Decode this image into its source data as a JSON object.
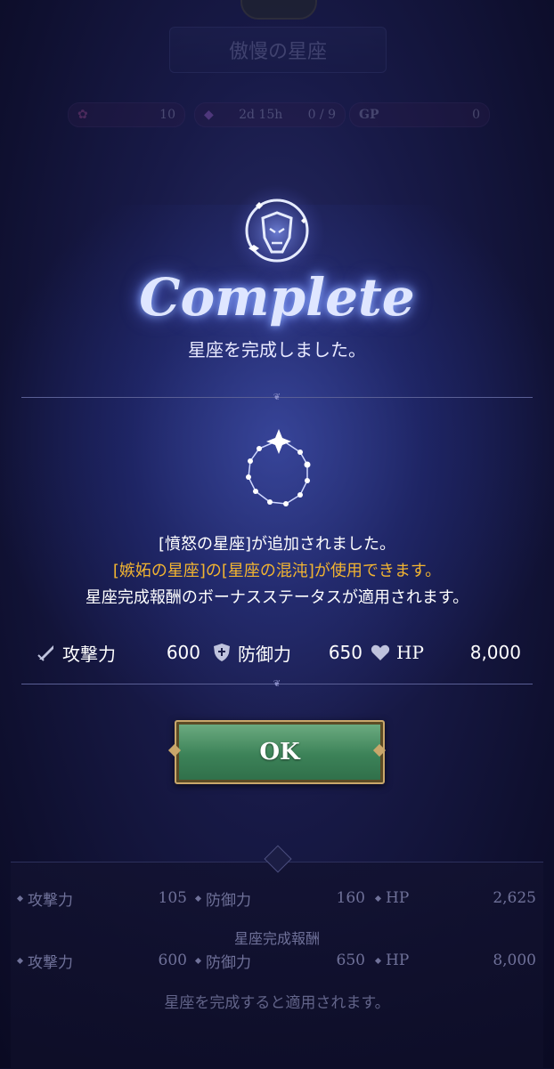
{
  "background": {
    "title": "傲慢の星座",
    "stats": [
      {
        "icon": "flower-icon",
        "value": "10"
      },
      {
        "icon": "gem-icon",
        "timer": "2d 15h",
        "progress": "0 / 9"
      },
      {
        "icon": "gp-icon",
        "label": "GP",
        "value": "0"
      }
    ]
  },
  "dialog": {
    "title": "Complete",
    "subtitle": "星座を完成しました。",
    "messages": {
      "line1": "[憤怒の星座]が追加されました。",
      "line2": "[嫉妬の星座]の[星座の混沌]が使用できます。",
      "line3": "星座完成報酬のボーナスステータスが適用されます。"
    },
    "bonus": {
      "attack_label": "攻撃力",
      "attack_value": "600",
      "defense_label": "防御力",
      "defense_value": "650",
      "hp_label": "HP",
      "hp_value": "8,000"
    },
    "ok_label": "OK"
  },
  "bottom": {
    "row1": {
      "attack_label": "攻撃力",
      "attack_value": "105",
      "defense_label": "防御力",
      "defense_value": "160",
      "hp_label": "HP",
      "hp_value": "2,625"
    },
    "caption": "星座完成報酬",
    "row2": {
      "attack_label": "攻撃力",
      "attack_value": "600",
      "defense_label": "防御力",
      "defense_value": "650",
      "hp_label": "HP",
      "hp_value": "8,000"
    },
    "note": "星座を完成すると適用されます。"
  },
  "colors": {
    "accent_gold": "#f2b431",
    "ok_green": "#3c8258",
    "frame_gold": "#c9a76b"
  }
}
